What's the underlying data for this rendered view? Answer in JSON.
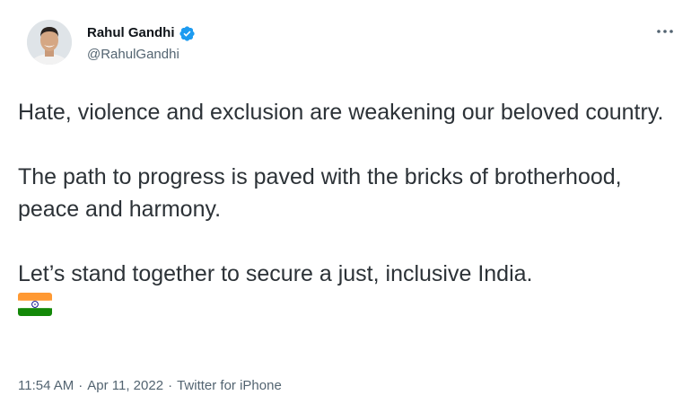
{
  "author": {
    "display_name": "Rahul Gandhi",
    "handle": "@RahulGandhi",
    "verified": true,
    "verified_color": "#1d9bf0",
    "avatar_icon": "profile-photo"
  },
  "menu": {
    "icon": "more-horizontal-icon"
  },
  "tweet": {
    "paragraphs": [
      "Hate, violence and exclusion are weakening our beloved country.",
      "The path to progress is paved with the bricks of brotherhood, peace and harmony.",
      "Let’s stand together to secure a just, inclusive India."
    ],
    "emoji": "india-flag-icon"
  },
  "meta": {
    "time": "11:54 AM",
    "separator": "·",
    "date": "Apr 11, 2022",
    "source": "Twitter for iPhone"
  },
  "colors": {
    "text_primary": "#0f1419",
    "text_secondary": "#536471",
    "accent": "#1d9bf0"
  }
}
